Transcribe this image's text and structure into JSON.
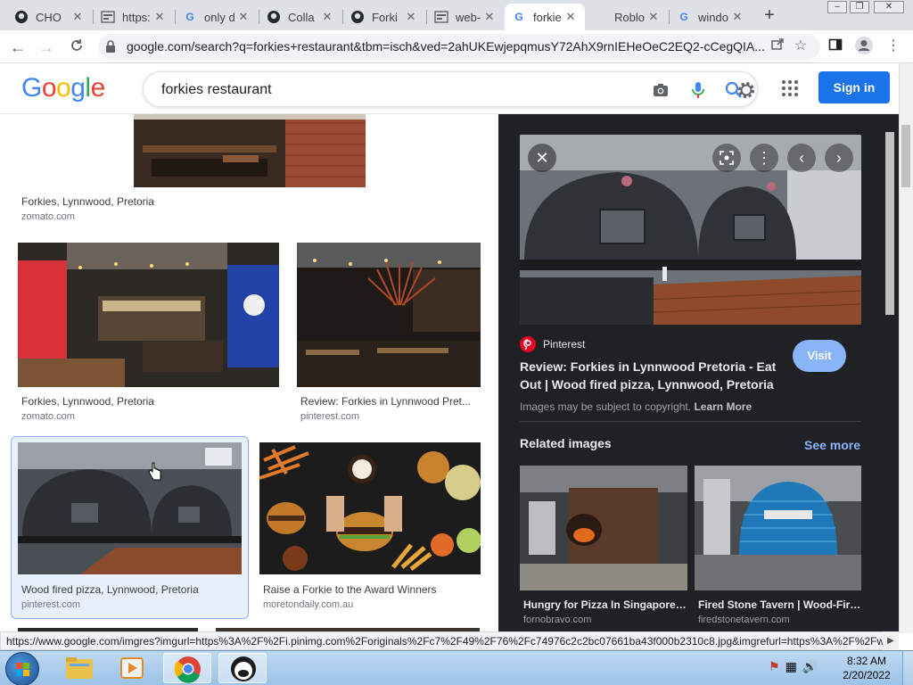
{
  "browser": {
    "tabs": [
      {
        "title": "CHO",
        "icon": "github-icon",
        "active": false
      },
      {
        "title": "https:",
        "icon": "webpage-icon",
        "active": false
      },
      {
        "title": "only d",
        "icon": "google-icon",
        "active": false
      },
      {
        "title": "Colla",
        "icon": "github-icon",
        "active": false
      },
      {
        "title": "Forki",
        "icon": "github-icon",
        "active": false
      },
      {
        "title": "web-",
        "icon": "webpage-icon",
        "active": false
      },
      {
        "title": "forkie",
        "icon": "google-icon",
        "active": true
      },
      {
        "title": "Roblo",
        "icon": "roblox-icon",
        "active": false
      },
      {
        "title": "windo",
        "icon": "google-icon",
        "active": false
      }
    ],
    "url": "google.com/search?q=forkies+restaurant&tbm=isch&ved=2ahUKEwjepqmusY72AhX9rnIEHeOeC2EQ2-cCegQIA...",
    "status_url": "https://www.google.com/imgres?imgurl=https%3A%2F%2Fi.pinimg.com%2Foriginals%2Fc7%2F49%2F76%2Fc74976c2c2bc07661ba43f000b2310c8.jpg&imgrefurl=https%3A%2F%2Fw..."
  },
  "header": {
    "logo": "Google",
    "query": "forkies restaurant",
    "signin": "Sign in"
  },
  "results": [
    {
      "caption": "Forkies, Lynnwood, Pretoria",
      "source": "zomato.com"
    },
    {
      "caption": "Forkies, Lynnwood, Pretoria",
      "source": "zomato.com"
    },
    {
      "caption": "Review: Forkies in Lynnwood Pret...",
      "source": "pinterest.com"
    },
    {
      "caption": "Wood fired pizza, Lynnwood, Pretoria",
      "source": "pinterest.com"
    },
    {
      "caption": "Raise a Forkie to the Award Winners",
      "source": "moretondaily.com.au"
    }
  ],
  "panel": {
    "site": "Pinterest",
    "title": "Review: Forkies in Lynnwood Pretoria - Eat Out | Wood fired pizza, Lynnwood, Pretoria",
    "visit": "Visit",
    "copyright": "Images may be subject to copyright.",
    "learn_more": "Learn More",
    "related_heading": "Related images",
    "see_more": "See more",
    "related": [
      {
        "caption": "Hungry for Pizza In Singapore | ...",
        "source": "fornobravo.com"
      },
      {
        "caption": "Fired Stone Tavern | Wood-Fire...",
        "source": "firedstonetavern.com"
      }
    ]
  },
  "taskbar": {
    "time": "8:32 AM",
    "date": "2/20/2022"
  },
  "colors": {
    "signin_blue": "#1a73e8",
    "panel_bg": "#202124",
    "link_blue": "#8ab4f8",
    "pinterest_red": "#e60023"
  }
}
